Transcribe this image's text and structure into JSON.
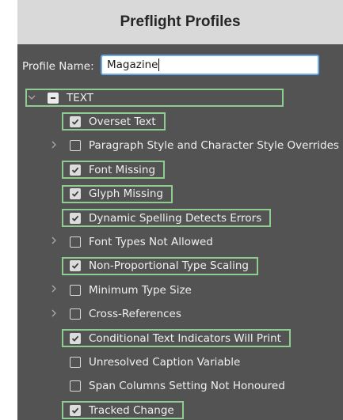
{
  "window": {
    "title": "Preflight Profiles"
  },
  "profile": {
    "label": "Profile Name:",
    "value": "Magazine"
  },
  "tree": {
    "root": {
      "label": "TEXT",
      "state": "mixed",
      "expanded": true
    },
    "items": [
      {
        "label": "Overset Text",
        "checked": true,
        "expandable": false
      },
      {
        "label": "Paragraph Style and Character Style Overrides",
        "checked": false,
        "expandable": true
      },
      {
        "label": "Font Missing",
        "checked": true,
        "expandable": false
      },
      {
        "label": "Glyph Missing",
        "checked": true,
        "expandable": false
      },
      {
        "label": "Dynamic Spelling Detects Errors",
        "checked": true,
        "expandable": false
      },
      {
        "label": "Font Types Not Allowed",
        "checked": false,
        "expandable": true
      },
      {
        "label": "Non-Proportional Type Scaling",
        "checked": true,
        "expandable": false
      },
      {
        "label": "Minimum Type Size",
        "checked": false,
        "expandable": true
      },
      {
        "label": "Cross-References",
        "checked": false,
        "expandable": true
      },
      {
        "label": "Conditional Text Indicators Will Print",
        "checked": true,
        "expandable": false
      },
      {
        "label": "Unresolved Caption Variable",
        "checked": false,
        "expandable": false
      },
      {
        "label": "Span Columns Setting Not Honoured",
        "checked": false,
        "expandable": false
      },
      {
        "label": "Tracked Change",
        "checked": true,
        "expandable": false
      }
    ]
  },
  "colors": {
    "panel": "#535353",
    "titlebar": "#d9d9d9",
    "highlight": "#8fcc8f",
    "input_focus": "#6aa9e9"
  }
}
